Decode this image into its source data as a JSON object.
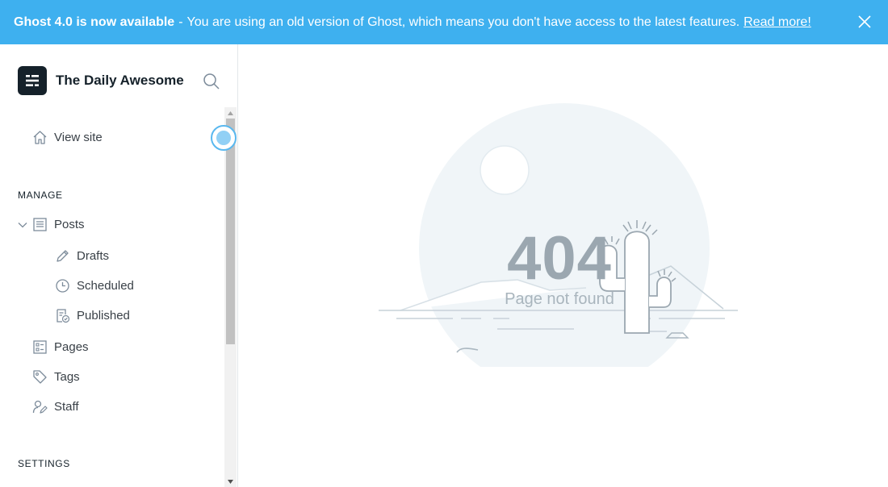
{
  "banner": {
    "strong": "Ghost 4.0 is now available",
    "separator": "-",
    "message": "You are using an old version of Ghost, which means you don't have access to the latest features.",
    "link": "Read more!",
    "background": "#3eb0ef",
    "close_icon": "close-icon"
  },
  "sidebar": {
    "brand_title": "The Daily Awesome",
    "view_site": "View site",
    "manage_heading": "MANAGE",
    "items": {
      "posts": "Posts",
      "drafts": "Drafts",
      "scheduled": "Scheduled",
      "published": "Published",
      "pages": "Pages",
      "tags": "Tags",
      "staff": "Staff"
    },
    "settings_heading": "SETTINGS"
  },
  "error": {
    "code": "404",
    "message": "Page not found"
  }
}
